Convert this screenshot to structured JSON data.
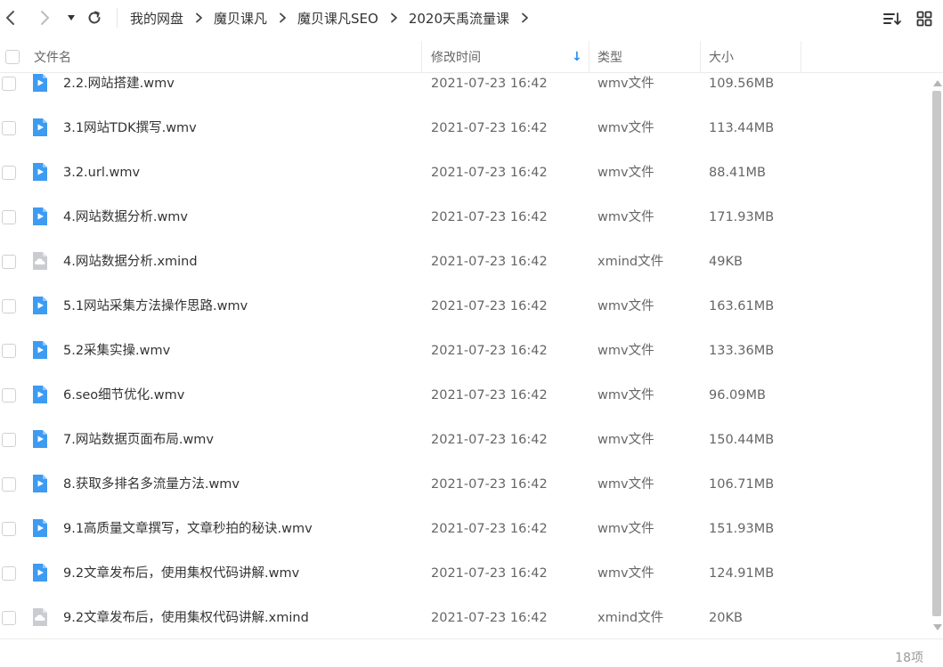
{
  "toolbar": {
    "back_icon": "chevron-left-icon",
    "forward_icon": "chevron-right-icon",
    "history_icon": "caret-down-icon",
    "refresh_icon": "refresh-icon",
    "sort_icon": "sort-list-icon",
    "view_icon": "grid-view-icon"
  },
  "breadcrumb": [
    "我的网盘",
    "魔贝课凡",
    "魔贝课凡SEO",
    "2020天禹流量课"
  ],
  "columns": {
    "name": "文件名",
    "modified": "修改时间",
    "type": "类型",
    "size": "大小",
    "sort_indicator": "↓"
  },
  "colors": {
    "video_icon": "#3d9bf2",
    "xmind_icon": "#c9ccd1",
    "sort_arrow": "#2d8cf0"
  },
  "files": [
    {
      "name": "2.2.网站搭建.wmv",
      "date": "2021-07-23 16:42",
      "type": "wmv文件",
      "size": "109.56MB",
      "icon": "video-file-icon"
    },
    {
      "name": "3.1网站TDK撰写.wmv",
      "date": "2021-07-23 16:42",
      "type": "wmv文件",
      "size": "113.44MB",
      "icon": "video-file-icon"
    },
    {
      "name": "3.2.url.wmv",
      "date": "2021-07-23 16:42",
      "type": "wmv文件",
      "size": "88.41MB",
      "icon": "video-file-icon"
    },
    {
      "name": "4.网站数据分析.wmv",
      "date": "2021-07-23 16:42",
      "type": "wmv文件",
      "size": "171.93MB",
      "icon": "video-file-icon"
    },
    {
      "name": "4.网站数据分析.xmind",
      "date": "2021-07-23 16:42",
      "type": "xmind文件",
      "size": "49KB",
      "icon": "cloud-file-icon"
    },
    {
      "name": "5.1网站采集方法操作思路.wmv",
      "date": "2021-07-23 16:42",
      "type": "wmv文件",
      "size": "163.61MB",
      "icon": "video-file-icon"
    },
    {
      "name": "5.2采集实操.wmv",
      "date": "2021-07-23 16:42",
      "type": "wmv文件",
      "size": "133.36MB",
      "icon": "video-file-icon"
    },
    {
      "name": "6.seo细节优化.wmv",
      "date": "2021-07-23 16:42",
      "type": "wmv文件",
      "size": "96.09MB",
      "icon": "video-file-icon"
    },
    {
      "name": "7.网站数据页面布局.wmv",
      "date": "2021-07-23 16:42",
      "type": "wmv文件",
      "size": "150.44MB",
      "icon": "video-file-icon"
    },
    {
      "name": "8.获取多排名多流量方法.wmv",
      "date": "2021-07-23 16:42",
      "type": "wmv文件",
      "size": "106.71MB",
      "icon": "video-file-icon"
    },
    {
      "name": "9.1高质量文章撰写，文章秒拍的秘诀.wmv",
      "date": "2021-07-23 16:42",
      "type": "wmv文件",
      "size": "151.93MB",
      "icon": "video-file-icon"
    },
    {
      "name": "9.2文章发布后，使用集权代码讲解.wmv",
      "date": "2021-07-23 16:42",
      "type": "wmv文件",
      "size": "124.91MB",
      "icon": "video-file-icon"
    },
    {
      "name": "9.2文章发布后，使用集权代码讲解.xmind",
      "date": "2021-07-23 16:42",
      "type": "xmind文件",
      "size": "20KB",
      "icon": "cloud-file-icon"
    }
  ],
  "footer": {
    "count": "18项"
  }
}
